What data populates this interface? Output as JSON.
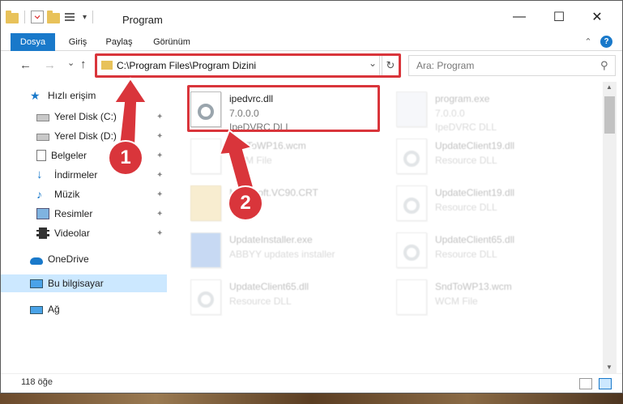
{
  "window": {
    "title": "Program",
    "minimize": "—",
    "maximize": "☐",
    "close": "✕"
  },
  "ribbon": {
    "tabs": [
      "Dosya",
      "Giriş",
      "Paylaş",
      "Görünüm"
    ],
    "collapse": "⌃",
    "help": "?"
  },
  "nav": {
    "back": "←",
    "forward": "→",
    "recent": "⌄",
    "up": "↑",
    "address": "C:\\Program Files\\Program Dizini",
    "dropdown": "⌄",
    "refresh": "↻",
    "search_placeholder": "Ara: Program",
    "search_icon": "⚲"
  },
  "sidebar": {
    "items": [
      {
        "label": "Hızlı erişim",
        "icon": "star-icon",
        "pinned": false
      },
      {
        "label": "Yerel Disk (C:)",
        "icon": "drive-icon",
        "pinned": true
      },
      {
        "label": "Yerel Disk (D:)",
        "icon": "drive-icon",
        "pinned": true
      },
      {
        "label": "Belgeler",
        "icon": "documents-icon",
        "pinned": true
      },
      {
        "label": "İndirmeler",
        "icon": "download-icon",
        "pinned": true
      },
      {
        "label": "Müzik",
        "icon": "music-icon",
        "pinned": true
      },
      {
        "label": "Resimler",
        "icon": "pictures-icon",
        "pinned": true
      },
      {
        "label": "Videolar",
        "icon": "video-icon",
        "pinned": true
      },
      {
        "label": "OneDrive",
        "icon": "cloud-icon",
        "pinned": false
      },
      {
        "label": "Bu bilgisayar",
        "icon": "computer-icon",
        "pinned": false
      },
      {
        "label": "Ağ",
        "icon": "network-icon",
        "pinned": false
      }
    ],
    "pin_glyph": "📌"
  },
  "files": [
    {
      "name": "ipedvrc.dll",
      "line2": "7.0.0.0",
      "line3": "IpeDVRC DLL"
    },
    {
      "name": "program.exe",
      "line2": "7.0.0.0",
      "line3": "IpeDVRC DLL"
    },
    {
      "name": "SndToWP16.wcm",
      "line2": "WCM File",
      "line3": ""
    },
    {
      "name": "UpdateClient19.dll",
      "line2": "Resource DLL",
      "line3": ""
    },
    {
      "name": "Microsoft.VC90.CRT",
      "line2": "",
      "line3": ""
    },
    {
      "name": "UpdateClient19.dll",
      "line2": "Resource DLL",
      "line3": ""
    },
    {
      "name": "UpdateInstaller.exe",
      "line2": "ABBYY updates installer",
      "line3": ""
    },
    {
      "name": "UpdateClient65.dll",
      "line2": "Resource DLL",
      "line3": ""
    },
    {
      "name": "UpdateClient65.dll",
      "line2": "Resource DLL",
      "line3": ""
    },
    {
      "name": "SndToWP13.wcm",
      "line2": "WCM File",
      "line3": ""
    }
  ],
  "status": {
    "count": "118 öğe"
  },
  "callouts": {
    "one": "1",
    "two": "2"
  },
  "colors": {
    "accent": "#1979ca",
    "highlight": "#d9353b",
    "selected": "#cce8ff"
  }
}
